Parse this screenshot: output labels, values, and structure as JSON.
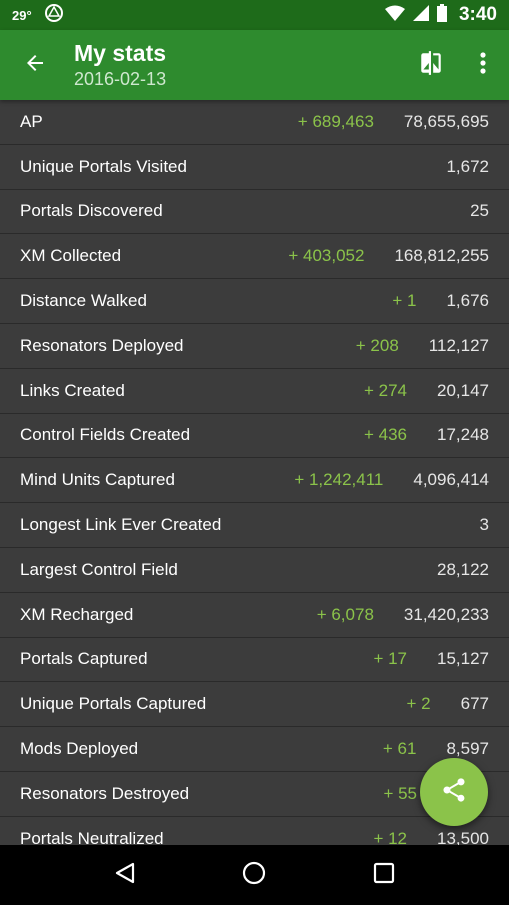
{
  "status_bar": {
    "temperature": "29°",
    "time": "3:40",
    "icons": [
      "ingress-icon",
      "wifi-icon",
      "signal-icon",
      "battery-icon"
    ]
  },
  "app_bar": {
    "title": "My stats",
    "subtitle": "2016-02-13",
    "icons": [
      "back-arrow-icon",
      "compare-icon",
      "overflow-menu-icon"
    ]
  },
  "colors": {
    "status_bar": "#1e6b1a",
    "app_bar": "#2e8b2e",
    "delta_text": "#8bc34a",
    "fab": "#8bc34a",
    "row_background": "#3c3c3c"
  },
  "stats": [
    {
      "label": "AP",
      "delta": "+ 689,463",
      "value": "78,655,695"
    },
    {
      "label": "Unique Portals Visited",
      "delta": "",
      "value": "1,672"
    },
    {
      "label": "Portals Discovered",
      "delta": "",
      "value": "25"
    },
    {
      "label": "XM Collected",
      "delta": "+ 403,052",
      "value": "168,812,255"
    },
    {
      "label": "Distance Walked",
      "delta": "+ 1",
      "value": "1,676"
    },
    {
      "label": "Resonators Deployed",
      "delta": "+ 208",
      "value": "112,127"
    },
    {
      "label": "Links Created",
      "delta": "+ 274",
      "value": "20,147"
    },
    {
      "label": "Control Fields Created",
      "delta": "+ 436",
      "value": "17,248"
    },
    {
      "label": "Mind Units Captured",
      "delta": "+ 1,242,411",
      "value": "4,096,414"
    },
    {
      "label": "Longest Link Ever Created",
      "delta": "",
      "value": "3"
    },
    {
      "label": "Largest Control Field",
      "delta": "",
      "value": "28,122"
    },
    {
      "label": "XM Recharged",
      "delta": "+ 6,078",
      "value": "31,420,233"
    },
    {
      "label": "Portals Captured",
      "delta": "+ 17",
      "value": "15,127"
    },
    {
      "label": "Unique Portals Captured",
      "delta": "+ 2",
      "value": "677"
    },
    {
      "label": "Mods Deployed",
      "delta": "+ 61",
      "value": "8,597"
    },
    {
      "label": "Resonators Destroyed",
      "delta": "+ 55",
      "value": ""
    },
    {
      "label": "Portals Neutralized",
      "delta": "+ 12",
      "value": "13,500"
    }
  ],
  "fab": {
    "icon": "share-icon"
  },
  "nav_bar": {
    "icons": [
      "back-triangle-icon",
      "home-circle-icon",
      "recents-square-icon"
    ]
  }
}
